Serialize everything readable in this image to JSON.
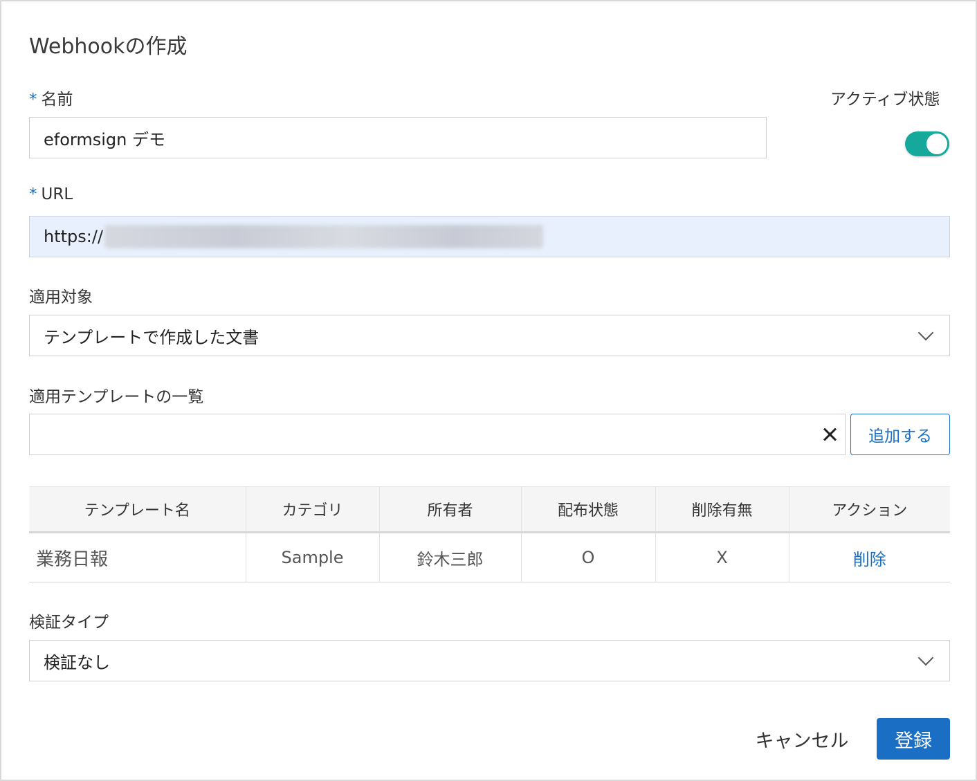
{
  "dialog": {
    "title": "Webhookの作成"
  },
  "name_field": {
    "required_mark": "*",
    "label": "名前",
    "value": "eformsign デモ"
  },
  "active": {
    "label": "アクティブ状態",
    "on": true,
    "accent_color": "#16a89a"
  },
  "url_field": {
    "required_mark": "*",
    "label": "URL",
    "value": "https://"
  },
  "target": {
    "label": "適用対象",
    "selected": "テンプレートで作成した文書"
  },
  "template_list": {
    "label": "適用テンプレートの一覧",
    "search_value": "",
    "clear_icon": "close-icon",
    "add_label": "追加する"
  },
  "table": {
    "headers": [
      "テンプレート名",
      "カテゴリ",
      "所有者",
      "配布状態",
      "削除有無",
      "アクション"
    ],
    "rows": [
      {
        "name": "業務日報",
        "category": "Sample",
        "owner": "鈴木三郎",
        "distributed": "O",
        "deleted": "X",
        "action": "削除"
      }
    ]
  },
  "verify": {
    "label": "検証タイプ",
    "selected": "検証なし"
  },
  "footer": {
    "cancel_label": "キャンセル",
    "submit_label": "登録",
    "primary_color": "#1a6fc4"
  }
}
